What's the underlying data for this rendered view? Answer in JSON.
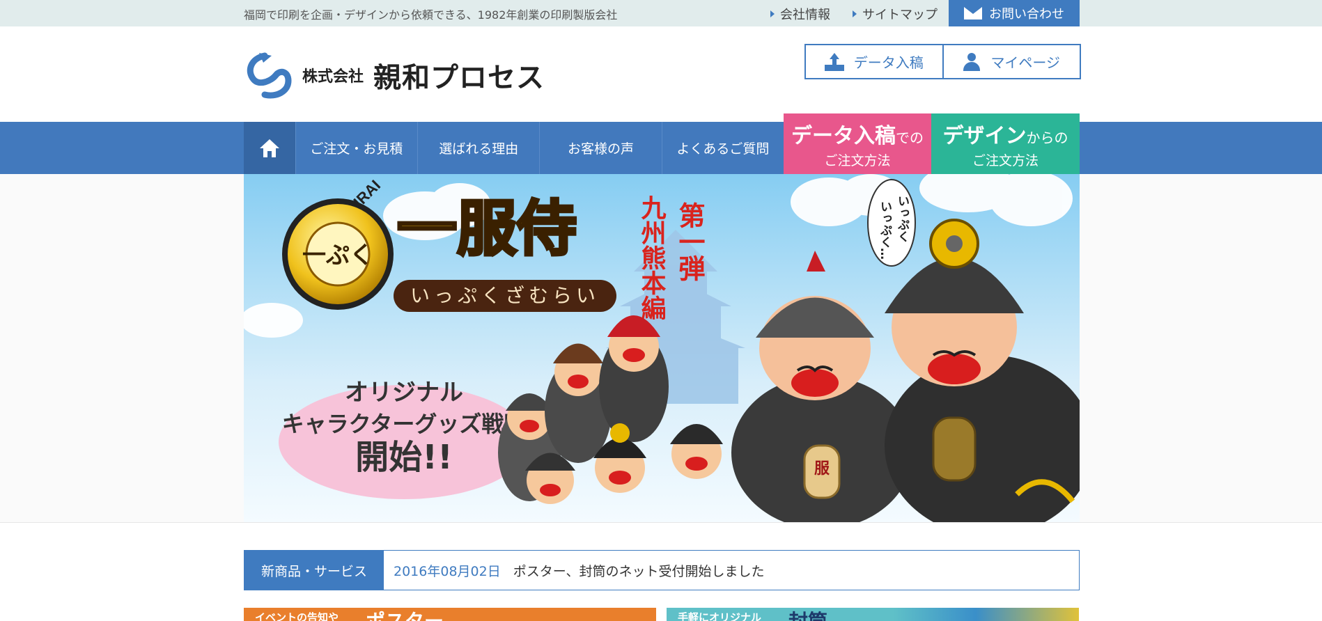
{
  "topbar": {
    "tagline": "福岡で印刷を企画・デザインから依頼できる、1982年創業の印刷製版会社",
    "links": [
      "会社情報",
      "サイトマップ"
    ],
    "contact_label": "お問い合わせ"
  },
  "header": {
    "company_prefix": "株式会社",
    "company_name": "親和プロセス",
    "buttons": {
      "upload_label": "データ入稿",
      "mypage_label": "マイページ"
    }
  },
  "nav": {
    "items": [
      "ご注文・お見積",
      "選ばれる理由",
      "お客様の声",
      "よくあるご質問"
    ],
    "promo_data": {
      "big": "データ入稿",
      "small": "での",
      "line2": "ご注文方法"
    },
    "promo_design": {
      "big": "デザイン",
      "small": "からの",
      "line2": "ご注文方法"
    }
  },
  "hero": {
    "brand_arc": "RELAX SAMURAI",
    "medallion": "一ぷく",
    "title": "一服侍",
    "subtitle": "いっぷくざむらい",
    "vertical_1": "第一弾",
    "vertical_2": "九州熊本編",
    "speech": [
      "いっぷく",
      "いっぷく…"
    ],
    "bubble_lines": [
      "オリジナル",
      "キャラクターグッズ戦略",
      "開始!!"
    ],
    "badge_text": "服"
  },
  "news": {
    "label": "新商品・サービス",
    "date": "2016年08月02日",
    "text": "ポスター、封筒のネット受付開始しました"
  },
  "banners": {
    "left_small": "イベントの告知や",
    "left_big": "ポスター",
    "right_small": "手軽にオリジナル",
    "right_big": "封筒"
  },
  "colors": {
    "brand_blue": "#4279bd",
    "pink": "#e8578c",
    "green": "#2bb597",
    "topbar_bg": "#e1ecec"
  }
}
